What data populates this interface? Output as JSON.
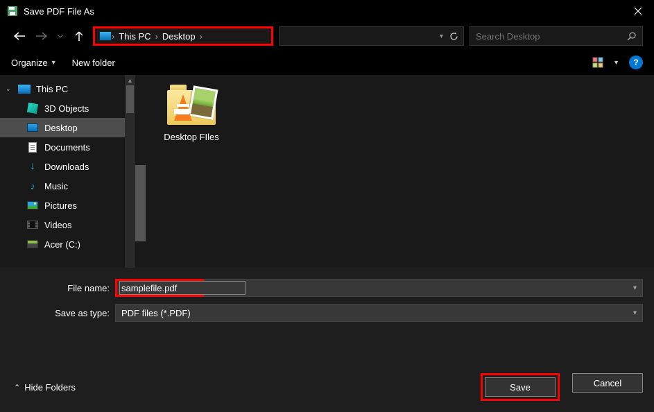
{
  "titlebar": {
    "title": "Save PDF File As"
  },
  "nav": {
    "breadcrumbs": [
      "This PC",
      "Desktop"
    ],
    "search_placeholder": "Search Desktop"
  },
  "toolbar": {
    "organize": "Organize",
    "newfolder": "New folder"
  },
  "sidebar": {
    "root": "This PC",
    "items": [
      {
        "label": "3D Objects",
        "icon": "3d"
      },
      {
        "label": "Desktop",
        "icon": "desktop",
        "selected": true
      },
      {
        "label": "Documents",
        "icon": "doc"
      },
      {
        "label": "Downloads",
        "icon": "dl"
      },
      {
        "label": "Music",
        "icon": "music"
      },
      {
        "label": "Pictures",
        "icon": "pic"
      },
      {
        "label": "Videos",
        "icon": "vid"
      },
      {
        "label": "Acer (C:)",
        "icon": "drive"
      }
    ]
  },
  "content": {
    "folder0": {
      "label": "Desktop FIles"
    }
  },
  "fields": {
    "filename_label": "File name:",
    "filename_value": "samplefile.pdf",
    "type_label": "Save as type:",
    "type_value": "PDF files (*.PDF)"
  },
  "footer": {
    "hide_folders": "Hide Folders",
    "save": "Save",
    "cancel": "Cancel"
  },
  "highlight_color": "#ff0000"
}
